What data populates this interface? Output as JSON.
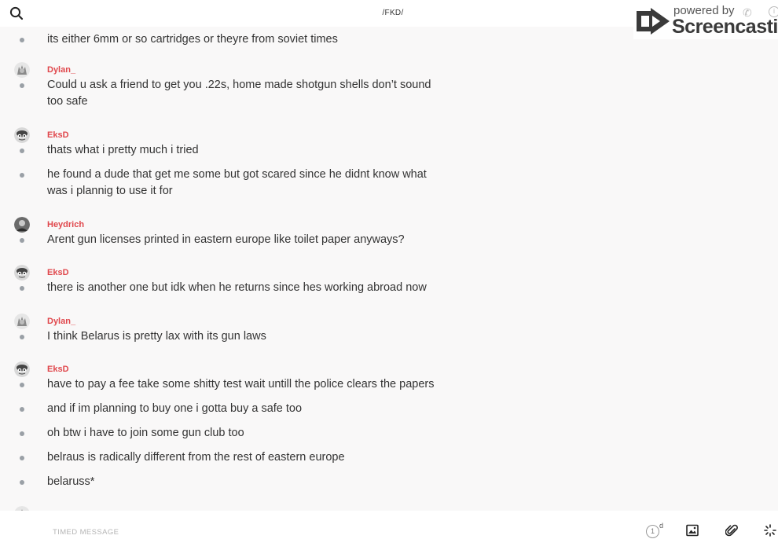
{
  "header": {
    "title": "/FKD/"
  },
  "watermark": {
    "powered": "powered by",
    "brand": "Screencastify"
  },
  "messages": {
    "m0": "its either 6mm or so cartridges or theyre from soviet times",
    "g1": {
      "user": "Dylan_",
      "l1": "Could u ask a friend to get you .22s, home made shotgun shells don’t sound",
      "l2": "too safe"
    },
    "g2": {
      "user": "EksD",
      "l1": "thats what i pretty much i tried",
      "l2a": "he found a dude that get me some but got scared since he didnt know what",
      "l2b": "was i plannig to use it for"
    },
    "g3": {
      "user": "Heydrich",
      "l1": "Arent gun licenses printed in eastern europe like toilet paper anyways?"
    },
    "g4": {
      "user": "EksD",
      "l1": "there is another one but idk when he returns since hes working abroad now"
    },
    "g5": {
      "user": "Dylan_",
      "l1": "I think Belarus is pretty lax with its gun laws"
    },
    "g6": {
      "user": "EksD",
      "l1": "have to pay a fee take some shitty test wait untill the police clears the papers",
      "l2": "and if im planning to buy one i gotta buy a safe too",
      "l3": "oh btw i have to join some gun club too",
      "l4": "belraus is radically different from the rest of eastern europe",
      "l5": "belaruss*"
    }
  },
  "composer": {
    "placeholder": "TIMED MESSAGE"
  },
  "timer": {
    "value": "1",
    "unit": "d"
  },
  "icons": {
    "search": "search-icon",
    "image": "image-icon",
    "attach": "paperclip-icon",
    "more": "spinner-icon"
  }
}
